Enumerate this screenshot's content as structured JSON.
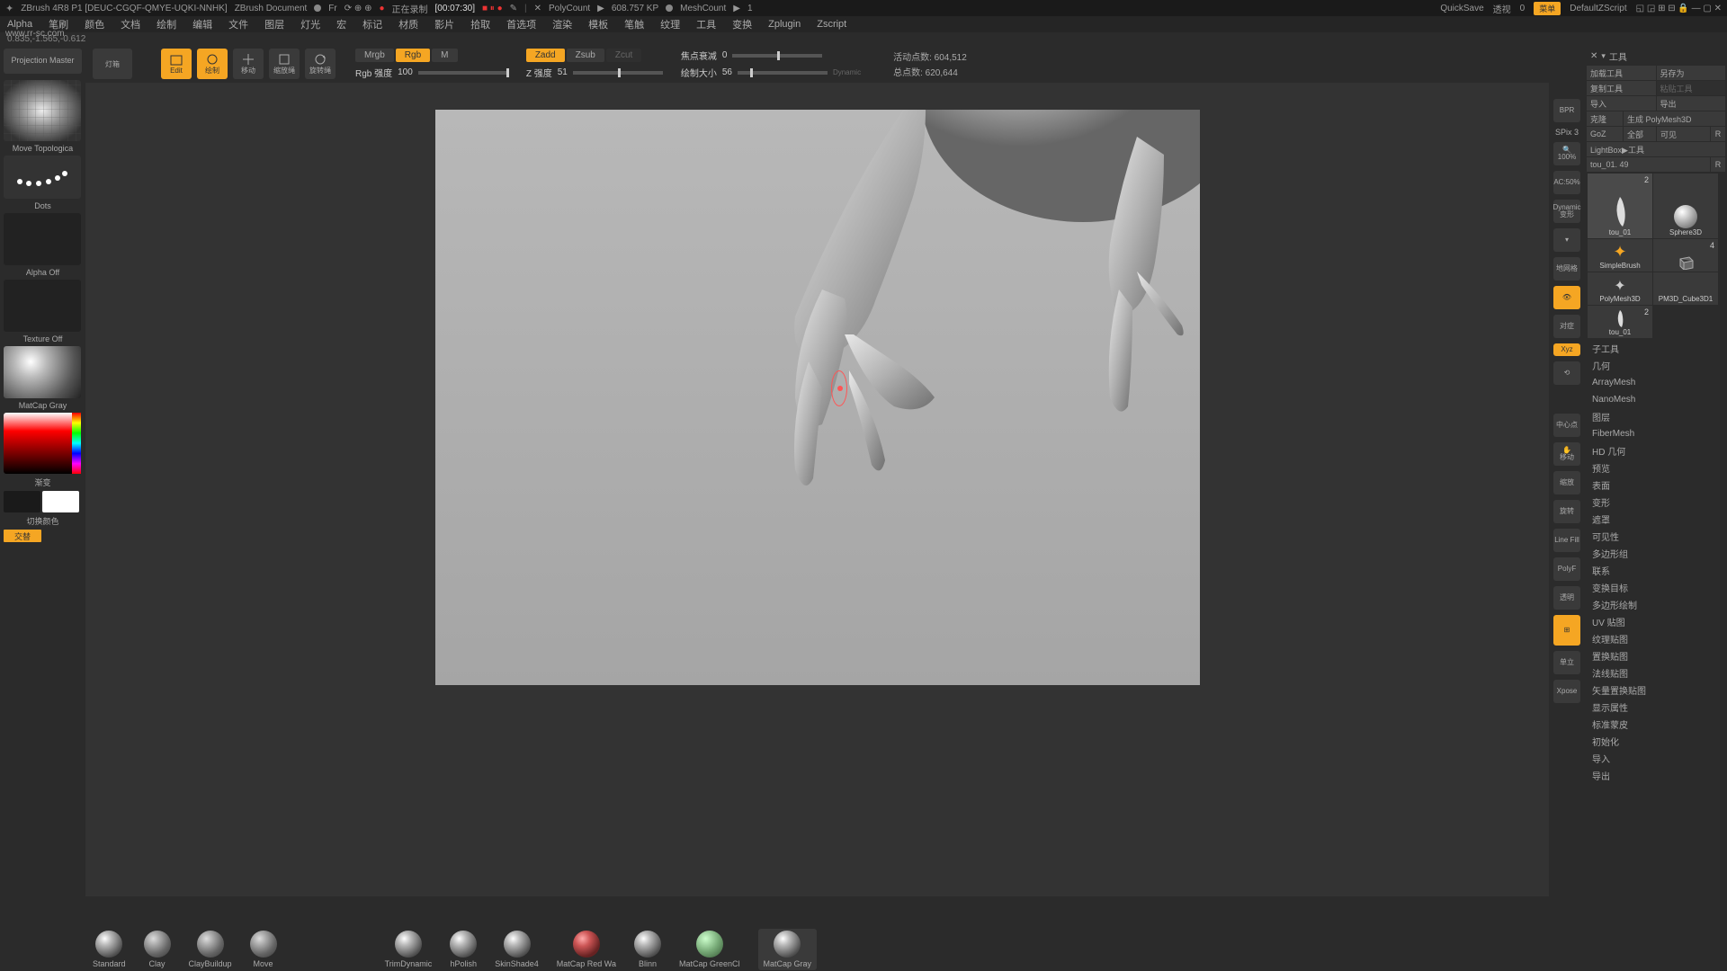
{
  "titlebar": {
    "app": "ZBrush 4R8 P1 [DEUC-CGQF-QMYE-UQKI-NNHK]",
    "doc": "ZBrush Document",
    "fr": "Fr",
    "recording": "正在录制",
    "rec_time": "[00:07:30]",
    "polycount_label": "PolyCount",
    "polycount_val": "608.757 KP",
    "meshcount_label": "MeshCount",
    "meshcount_val": "1",
    "quicksave": "QuickSave",
    "persp": "透视",
    "persp_val": "0",
    "menu_btn": "菜单",
    "default_zscript": "DefaultZScript"
  },
  "menubar": [
    "Alpha",
    "笔刷",
    "颜色",
    "文档",
    "绘制",
    "编辑",
    "文件",
    "图层",
    "灯光",
    "宏",
    "标记",
    "材质",
    "影片",
    "拾取",
    "首选项",
    "渲染",
    "模板",
    "笔触",
    "纹理",
    "工具",
    "变换",
    "Zplugin",
    "Zscript"
  ],
  "coords": "0.835,-1.565,-0.612",
  "left": {
    "proj_master": "Projection Master",
    "lightbox": "灯箱",
    "brush_name": "Move Topologica",
    "dots": "Dots",
    "alpha_off": "Alpha Off",
    "texture_off": "Texture Off",
    "matcap": "MatCap Gray",
    "gradient": "渐变",
    "swap": "切换颜色",
    "alt": "交替"
  },
  "top": {
    "edit": "Edit",
    "draw": "绘制",
    "move": "移动",
    "scale": "缩放绳",
    "rotate": "旋转绳",
    "mrgb": "Mrgb",
    "rgb": "Rgb",
    "m": "M",
    "zadd": "Zadd",
    "zsub": "Zsub",
    "zcut": "Zcut",
    "rgb_intensity_label": "Rgb 强度",
    "rgb_intensity_val": "100",
    "z_intensity_label": "Z 强度",
    "z_intensity_val": "51",
    "focal_label": "焦点衰减",
    "focal_val": "0",
    "draw_size_label": "绘制大小",
    "draw_size_val": "56",
    "dynamic": "Dynamic",
    "active_label": "活动点数:",
    "active_val": "604,512",
    "total_label": "总点数:",
    "total_val": "620,644"
  },
  "right_icons": {
    "bpr": "BPR",
    "spix": "SPix 3",
    "pct100": "100%",
    "pct50": "AC:50%",
    "dynamic": "Dynamic 变形",
    "grid": "地网格",
    "persp": "透立",
    "symm": "对症",
    "xyz": "Xyz",
    "center": "中心点",
    "move": "移动",
    "zoom": "缩放",
    "rot": "旋转",
    "linefill": "Line Fill",
    "polyf": "PolyF",
    "transp": "透明",
    "dyn2": "Dynamic",
    "solo": "单立",
    "xpose": "Xpose"
  },
  "right_panel": {
    "title": "工具",
    "load": "加载工具",
    "save_as": "另存为",
    "copy": "复制工具",
    "paste": "粘贴工具",
    "import": "导入",
    "export": "导出",
    "clone": "克隆",
    "make_polymesh": "生成 PolyMesh3D",
    "goz": "GoZ",
    "all": "全部",
    "visible": "可见",
    "r1": "R",
    "lightbox_tools": "LightBox▶工具",
    "current": "tou_01. 49",
    "r2": "R",
    "tools": [
      {
        "name": "tou_01",
        "num": "2",
        "sel": true
      },
      {
        "name": "Sphere3D",
        "num": ""
      },
      {
        "name": "",
        "num": ""
      },
      {
        "name": "SimpleBrush",
        "num": ""
      },
      {
        "name": "PolyMesh3D",
        "num": ""
      },
      {
        "name": "PM3D_Cube3D1",
        "num": "4"
      },
      {
        "name": "tou_01",
        "num": "2"
      }
    ],
    "sections": [
      "子工具",
      "几何",
      "ArrayMesh",
      "NanoMesh",
      "图层",
      "FiberMesh",
      "HD 几何",
      "预览",
      "表面",
      "变形",
      "遮罩",
      "可见性",
      "多边形组",
      "联系",
      "变换目标",
      "多边形绘制",
      "UV 贴图",
      "纹理贴图",
      "置换贴图",
      "法线贴图",
      "矢量置换贴图",
      "显示属性",
      "标准蒙皮",
      "初始化",
      "导入",
      "导出"
    ]
  },
  "brush_tray": [
    {
      "name": "Standard"
    },
    {
      "name": "Clay"
    },
    {
      "name": "ClayBuildup"
    },
    {
      "name": "Move"
    },
    {
      "name": "TrimDynamic"
    },
    {
      "name": "hPolish"
    },
    {
      "name": "SkinShade4"
    },
    {
      "name": "MatCap Red Wa"
    },
    {
      "name": "Blinn"
    },
    {
      "name": "MatCap GreenCl"
    },
    {
      "name": "MatCap Gray",
      "sel": true
    }
  ],
  "watermark_url": "www.rr-sc.com"
}
